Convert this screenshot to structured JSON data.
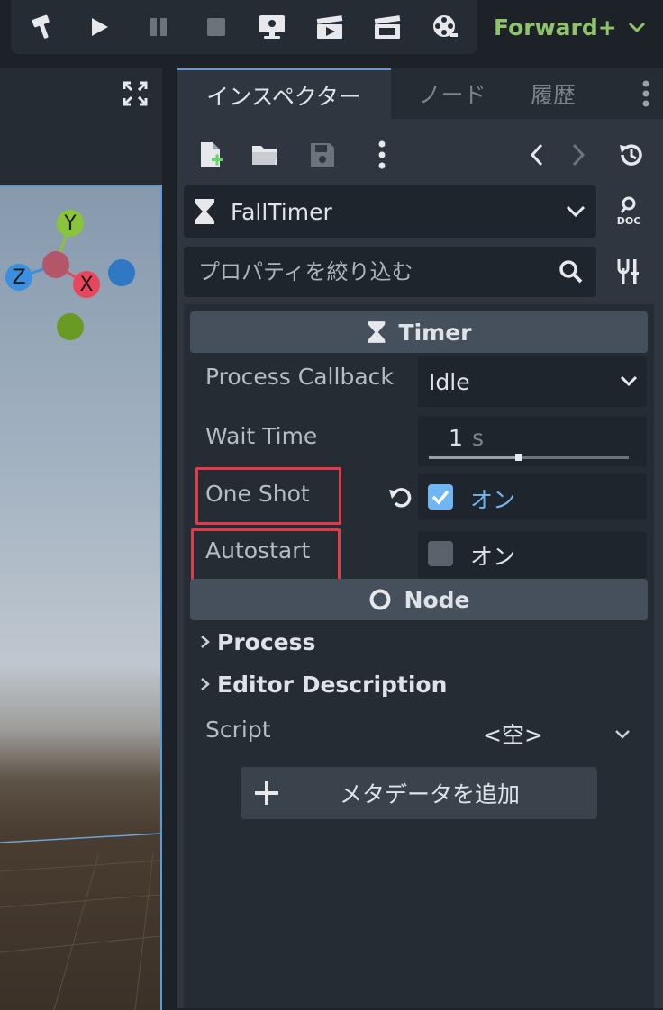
{
  "toolbar": {
    "buttons": [
      {
        "name": "build-button",
        "icon": "hammer-icon"
      },
      {
        "name": "play-button",
        "icon": "play-icon"
      },
      {
        "name": "pause-button",
        "icon": "pause-icon"
      },
      {
        "name": "stop-button",
        "icon": "stop-icon"
      },
      {
        "name": "remote-debug-button",
        "icon": "monitor-icon"
      },
      {
        "name": "play-scene-button",
        "icon": "clapper-play-icon"
      },
      {
        "name": "play-custom-scene-button",
        "icon": "clapper-icon"
      },
      {
        "name": "movie-maker-button",
        "icon": "film-reel-icon"
      }
    ],
    "renderer": "Forward+",
    "accent_color": "#8fc46a"
  },
  "viewport": {
    "gizmo": {
      "y": "Y",
      "z": "Z",
      "x": "X"
    },
    "colors": {
      "x": "#e8465c",
      "y": "#8ac43a",
      "z": "#3a8fe0",
      "selection_border": "#5f9ad3"
    }
  },
  "inspector": {
    "tabs": [
      {
        "label": "インスペクター",
        "active": true
      },
      {
        "label": "ノード",
        "active": false
      },
      {
        "label": "履歴",
        "active": false
      }
    ],
    "selected_node": "FallTimer",
    "filter_placeholder": "プロパティを絞り込む",
    "sections": {
      "timer": "Timer",
      "node": "Node"
    },
    "properties": {
      "process_callback": {
        "label": "Process Callback",
        "value": "Idle"
      },
      "wait_time": {
        "label": "Wait Time",
        "value": "1",
        "unit": "s",
        "slider_fraction": 0.45
      },
      "one_shot": {
        "label": "One Shot",
        "checked": true,
        "text": "オン"
      },
      "autostart": {
        "label": "Autostart",
        "checked": false,
        "text": "オン"
      }
    },
    "groups": {
      "process": "Process",
      "editor_description": "Editor Description"
    },
    "script": {
      "label": "Script",
      "value": "<空>"
    },
    "add_metadata": "メタデータを追加",
    "highlight_color": "#e23a4b",
    "check_color": "#6fb6f2"
  }
}
